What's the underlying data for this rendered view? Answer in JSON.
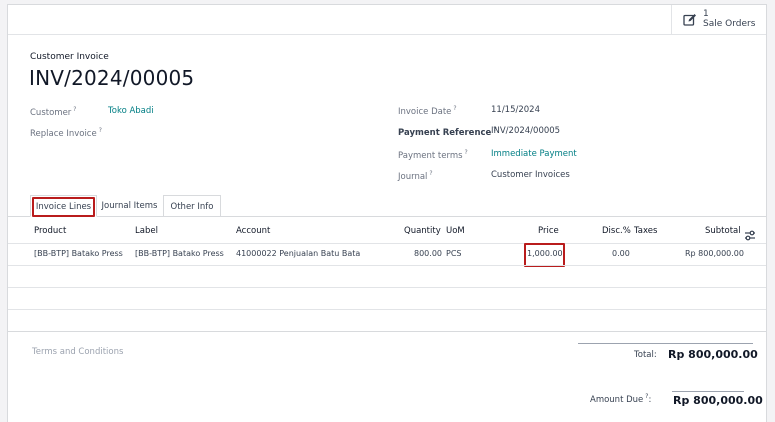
{
  "smart_button": {
    "count": "1",
    "label": "Sale Orders",
    "icon": "edit-icon"
  },
  "header": {
    "subtitle": "Customer Invoice",
    "name": "INV/2024/00005"
  },
  "fields": {
    "customer_label": "Customer",
    "customer_value": "Toko Abadi",
    "replace_label": "Replace Invoice",
    "invoice_date_label": "Invoice Date",
    "invoice_date_value": "11/15/2024",
    "payment_ref_label": "Payment Reference",
    "payment_ref_value": "INV/2024/00005",
    "payment_terms_label": "Payment terms",
    "payment_terms_value": "Immediate Payment",
    "journal_label": "Journal",
    "journal_value": "Customer Invoices",
    "help_mark": "?"
  },
  "tabs": [
    "Invoice Lines",
    "Journal Items",
    "Other Info"
  ],
  "table": {
    "headers": [
      "Product",
      "Label",
      "Account",
      "Quantity",
      "UoM",
      "Price",
      "Disc.%",
      "Taxes",
      "Subtotal"
    ],
    "rows": [
      [
        "[BB-BTP] Batako Press",
        "[BB-BTP] Batako Press",
        "41000022 Penjualan Batu Bata",
        "800.00",
        "PCS",
        "1,000.00",
        "0.00",
        "",
        "Rp 800,000.00"
      ]
    ],
    "settings_icon": "sliders-icon"
  },
  "footer": {
    "terms_placeholder": "Terms and Conditions",
    "total_label": "Total:",
    "total_value": "Rp 800,000.00",
    "amount_due_label": "Amount Due",
    "amount_due_value": "Rp 800,000.00",
    "help_mark": "?"
  },
  "colors": {
    "link": "#017e84",
    "highlight": "#b91c1c"
  }
}
